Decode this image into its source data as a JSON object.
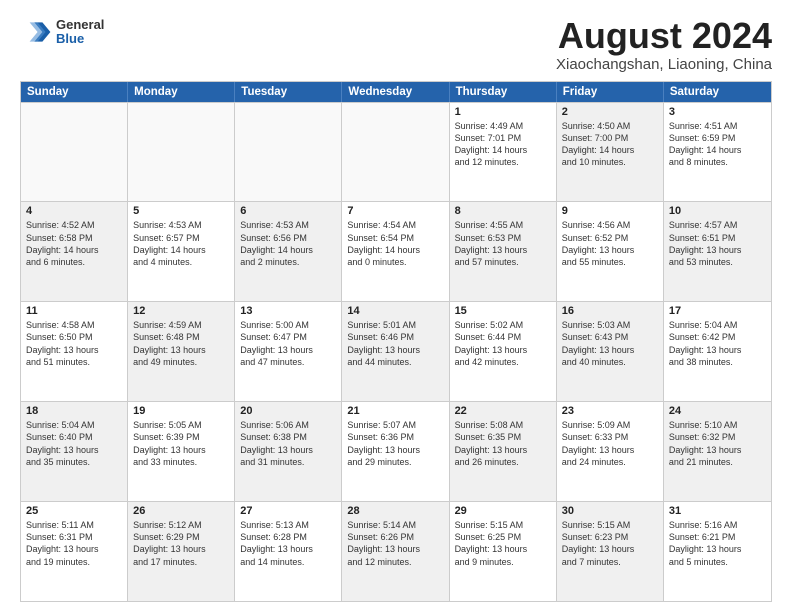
{
  "logo": {
    "general": "General",
    "blue": "Blue"
  },
  "title": "August 2024",
  "subtitle": "Xiaochangshan, Liaoning, China",
  "header_days": [
    "Sunday",
    "Monday",
    "Tuesday",
    "Wednesday",
    "Thursday",
    "Friday",
    "Saturday"
  ],
  "rows": [
    [
      {
        "day": "",
        "text": "",
        "empty": true
      },
      {
        "day": "",
        "text": "",
        "empty": true
      },
      {
        "day": "",
        "text": "",
        "empty": true
      },
      {
        "day": "",
        "text": "",
        "empty": true
      },
      {
        "day": "1",
        "text": "Sunrise: 4:49 AM\nSunset: 7:01 PM\nDaylight: 14 hours\nand 12 minutes.",
        "shaded": false
      },
      {
        "day": "2",
        "text": "Sunrise: 4:50 AM\nSunset: 7:00 PM\nDaylight: 14 hours\nand 10 minutes.",
        "shaded": true
      },
      {
        "day": "3",
        "text": "Sunrise: 4:51 AM\nSunset: 6:59 PM\nDaylight: 14 hours\nand 8 minutes.",
        "shaded": false
      }
    ],
    [
      {
        "day": "4",
        "text": "Sunrise: 4:52 AM\nSunset: 6:58 PM\nDaylight: 14 hours\nand 6 minutes.",
        "shaded": true
      },
      {
        "day": "5",
        "text": "Sunrise: 4:53 AM\nSunset: 6:57 PM\nDaylight: 14 hours\nand 4 minutes.",
        "shaded": false
      },
      {
        "day": "6",
        "text": "Sunrise: 4:53 AM\nSunset: 6:56 PM\nDaylight: 14 hours\nand 2 minutes.",
        "shaded": true
      },
      {
        "day": "7",
        "text": "Sunrise: 4:54 AM\nSunset: 6:54 PM\nDaylight: 14 hours\nand 0 minutes.",
        "shaded": false
      },
      {
        "day": "8",
        "text": "Sunrise: 4:55 AM\nSunset: 6:53 PM\nDaylight: 13 hours\nand 57 minutes.",
        "shaded": true
      },
      {
        "day": "9",
        "text": "Sunrise: 4:56 AM\nSunset: 6:52 PM\nDaylight: 13 hours\nand 55 minutes.",
        "shaded": false
      },
      {
        "day": "10",
        "text": "Sunrise: 4:57 AM\nSunset: 6:51 PM\nDaylight: 13 hours\nand 53 minutes.",
        "shaded": true
      }
    ],
    [
      {
        "day": "11",
        "text": "Sunrise: 4:58 AM\nSunset: 6:50 PM\nDaylight: 13 hours\nand 51 minutes.",
        "shaded": false
      },
      {
        "day": "12",
        "text": "Sunrise: 4:59 AM\nSunset: 6:48 PM\nDaylight: 13 hours\nand 49 minutes.",
        "shaded": true
      },
      {
        "day": "13",
        "text": "Sunrise: 5:00 AM\nSunset: 6:47 PM\nDaylight: 13 hours\nand 47 minutes.",
        "shaded": false
      },
      {
        "day": "14",
        "text": "Sunrise: 5:01 AM\nSunset: 6:46 PM\nDaylight: 13 hours\nand 44 minutes.",
        "shaded": true
      },
      {
        "day": "15",
        "text": "Sunrise: 5:02 AM\nSunset: 6:44 PM\nDaylight: 13 hours\nand 42 minutes.",
        "shaded": false
      },
      {
        "day": "16",
        "text": "Sunrise: 5:03 AM\nSunset: 6:43 PM\nDaylight: 13 hours\nand 40 minutes.",
        "shaded": true
      },
      {
        "day": "17",
        "text": "Sunrise: 5:04 AM\nSunset: 6:42 PM\nDaylight: 13 hours\nand 38 minutes.",
        "shaded": false
      }
    ],
    [
      {
        "day": "18",
        "text": "Sunrise: 5:04 AM\nSunset: 6:40 PM\nDaylight: 13 hours\nand 35 minutes.",
        "shaded": true
      },
      {
        "day": "19",
        "text": "Sunrise: 5:05 AM\nSunset: 6:39 PM\nDaylight: 13 hours\nand 33 minutes.",
        "shaded": false
      },
      {
        "day": "20",
        "text": "Sunrise: 5:06 AM\nSunset: 6:38 PM\nDaylight: 13 hours\nand 31 minutes.",
        "shaded": true
      },
      {
        "day": "21",
        "text": "Sunrise: 5:07 AM\nSunset: 6:36 PM\nDaylight: 13 hours\nand 29 minutes.",
        "shaded": false
      },
      {
        "day": "22",
        "text": "Sunrise: 5:08 AM\nSunset: 6:35 PM\nDaylight: 13 hours\nand 26 minutes.",
        "shaded": true
      },
      {
        "day": "23",
        "text": "Sunrise: 5:09 AM\nSunset: 6:33 PM\nDaylight: 13 hours\nand 24 minutes.",
        "shaded": false
      },
      {
        "day": "24",
        "text": "Sunrise: 5:10 AM\nSunset: 6:32 PM\nDaylight: 13 hours\nand 21 minutes.",
        "shaded": true
      }
    ],
    [
      {
        "day": "25",
        "text": "Sunrise: 5:11 AM\nSunset: 6:31 PM\nDaylight: 13 hours\nand 19 minutes.",
        "shaded": false
      },
      {
        "day": "26",
        "text": "Sunrise: 5:12 AM\nSunset: 6:29 PM\nDaylight: 13 hours\nand 17 minutes.",
        "shaded": true
      },
      {
        "day": "27",
        "text": "Sunrise: 5:13 AM\nSunset: 6:28 PM\nDaylight: 13 hours\nand 14 minutes.",
        "shaded": false
      },
      {
        "day": "28",
        "text": "Sunrise: 5:14 AM\nSunset: 6:26 PM\nDaylight: 13 hours\nand 12 minutes.",
        "shaded": true
      },
      {
        "day": "29",
        "text": "Sunrise: 5:15 AM\nSunset: 6:25 PM\nDaylight: 13 hours\nand 9 minutes.",
        "shaded": false
      },
      {
        "day": "30",
        "text": "Sunrise: 5:15 AM\nSunset: 6:23 PM\nDaylight: 13 hours\nand 7 minutes.",
        "shaded": true
      },
      {
        "day": "31",
        "text": "Sunrise: 5:16 AM\nSunset: 6:21 PM\nDaylight: 13 hours\nand 5 minutes.",
        "shaded": false
      }
    ]
  ]
}
